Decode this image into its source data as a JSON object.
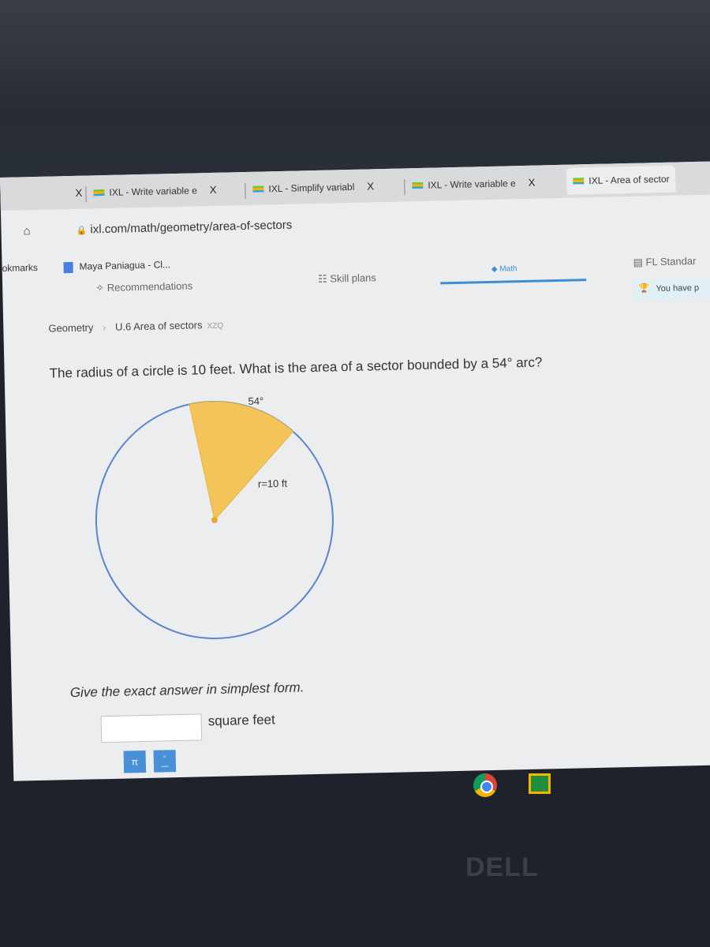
{
  "browser": {
    "tabs": [
      {
        "label": "IXL - Write variable e",
        "active": false
      },
      {
        "label": "IXL - Simplify variabl",
        "active": false
      },
      {
        "label": "IXL - Write variable e",
        "active": false
      },
      {
        "label": "IXL - Area of sector",
        "active": true
      }
    ],
    "close_label": "X",
    "url": "ixl.com/math/geometry/area-of-sectors",
    "bookmarks_label": "okmarks",
    "bookmark": "Maya Paniagua - Cl..."
  },
  "nav": {
    "recommendations": "Recommendations",
    "skill_plans": "Skill plans",
    "math": "Math",
    "standards": "FL Standar",
    "award": "You have p"
  },
  "breadcrumb": {
    "subject": "Geometry",
    "skill": "U.6 Area of sectors",
    "code": "XZQ"
  },
  "question": {
    "text": "The radius of a circle is 10 feet. What is the area of a sector bounded by a 54° arc?",
    "angle_label": "54°",
    "radius_label": "r=10 ft",
    "instruction": "Give the exact answer in simplest form.",
    "answer_value": "",
    "unit": "square feet",
    "pi_button": "π",
    "fraction_button": "fraction"
  },
  "colors": {
    "sector": "#f2c45a",
    "circle": "#5b83d0",
    "accent": "#3d8fd1"
  },
  "dell_logo": "DELL"
}
